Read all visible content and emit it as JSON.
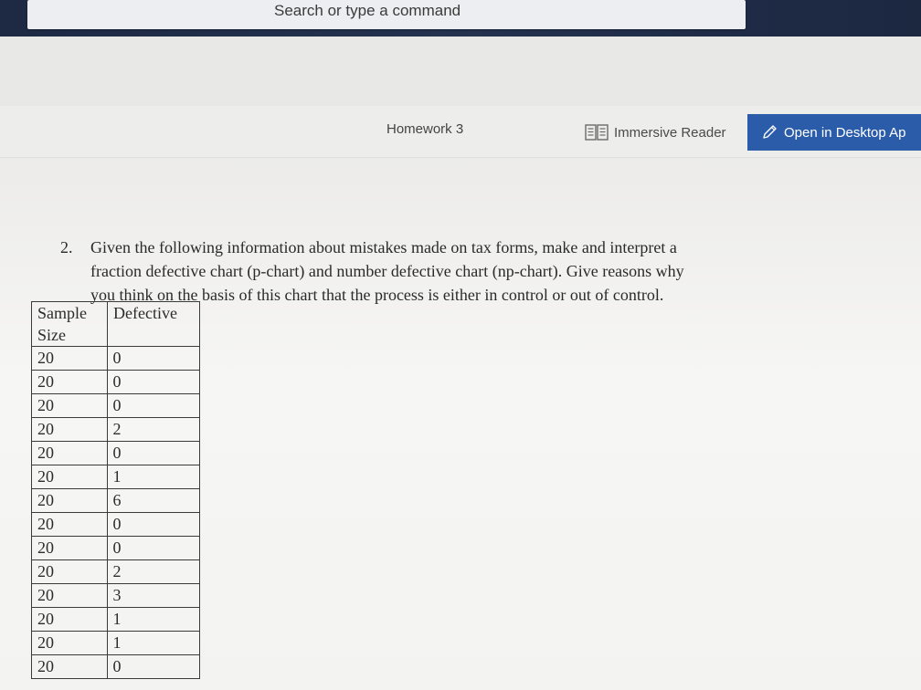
{
  "search": {
    "placeholder": "Search or type a command"
  },
  "commandbar": {
    "document_title": "Homework 3",
    "immersive_reader_label": "Immersive Reader",
    "open_desktop_label": "Open in Desktop Ap"
  },
  "question": {
    "number": "2.",
    "lines": [
      "Given the following information about mistakes made on tax forms, make and interpret a",
      "fraction defective chart (p-chart) and number defective chart (np-chart). Give reasons why",
      "you think on the basis of this chart that the process is either in control or out of control."
    ]
  },
  "table": {
    "headers": [
      "Sample Size",
      "Defective"
    ],
    "rows": [
      [
        "20",
        "0"
      ],
      [
        "20",
        "0"
      ],
      [
        "20",
        "0"
      ],
      [
        "20",
        "2"
      ],
      [
        "20",
        "0"
      ],
      [
        "20",
        "1"
      ],
      [
        "20",
        "6"
      ],
      [
        "20",
        "0"
      ],
      [
        "20",
        "0"
      ],
      [
        "20",
        "2"
      ],
      [
        "20",
        "3"
      ],
      [
        "20",
        "1"
      ],
      [
        "20",
        "1"
      ],
      [
        "20",
        "0"
      ]
    ]
  },
  "colors": {
    "topbar": "#1e2a44",
    "accent_button": "#2a5caa"
  },
  "icons": {
    "reader": "immersive-reader-icon",
    "pencil": "pencil-icon"
  }
}
